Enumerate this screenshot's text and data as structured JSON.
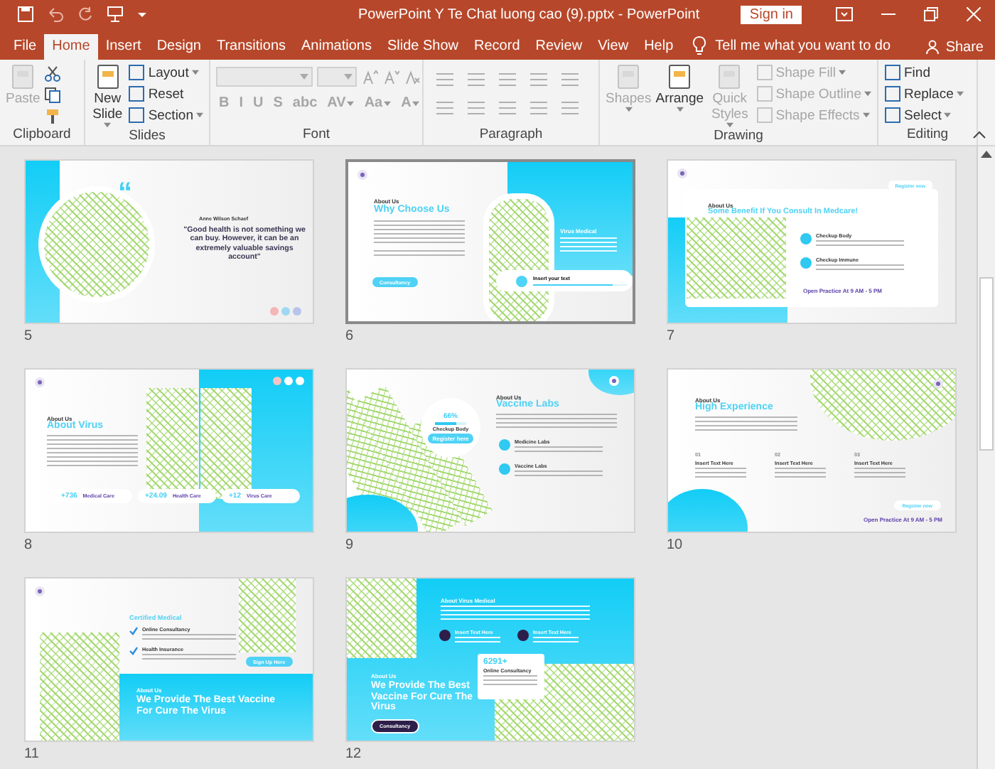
{
  "window": {
    "title": "PowerPoint Y Te Chat luong cao (9).pptx  -  PowerPoint",
    "sign_in": "Sign in"
  },
  "tabs": [
    {
      "label": "File",
      "selected": false
    },
    {
      "label": "Home",
      "selected": true
    },
    {
      "label": "Insert",
      "selected": false
    },
    {
      "label": "Design",
      "selected": false
    },
    {
      "label": "Transitions",
      "selected": false
    },
    {
      "label": "Animations",
      "selected": false
    },
    {
      "label": "Slide Show",
      "selected": false
    },
    {
      "label": "Record",
      "selected": false
    },
    {
      "label": "Review",
      "selected": false
    },
    {
      "label": "View",
      "selected": false
    },
    {
      "label": "Help",
      "selected": false
    }
  ],
  "tell_me": "Tell me what you want to do",
  "share": "Share",
  "ribbon": {
    "groups": [
      {
        "kind": "clipboard",
        "label": "Clipboard",
        "commands": [
          {
            "kind": "large",
            "label": "Paste",
            "disabled": true,
            "dropdown": false
          }
        ]
      },
      {
        "kind": "slides",
        "label": "Slides",
        "commands": [
          {
            "kind": "large",
            "label": "New Slide",
            "disabled": false,
            "dropdown": true
          },
          {
            "kind": "small",
            "label": "Layout",
            "disabled": false,
            "dropdown": true
          },
          {
            "kind": "small",
            "label": "Reset",
            "disabled": false,
            "dropdown": false
          },
          {
            "kind": "small",
            "label": "Section",
            "disabled": false,
            "dropdown": true
          }
        ]
      },
      {
        "kind": "font",
        "label": "Font",
        "commands": [
          {
            "kind": "char",
            "label": "B",
            "disabled": true,
            "dropdown": false
          },
          {
            "kind": "char",
            "label": "I",
            "disabled": true,
            "dropdown": false
          },
          {
            "kind": "char",
            "label": "U",
            "disabled": true,
            "dropdown": false
          },
          {
            "kind": "char",
            "label": "S",
            "disabled": true,
            "dropdown": false
          },
          {
            "kind": "char",
            "label": "abc",
            "disabled": true,
            "dropdown": false
          },
          {
            "kind": "char",
            "label": "AV",
            "disabled": true,
            "dropdown": true
          },
          {
            "kind": "char",
            "label": "Aa",
            "disabled": true,
            "dropdown": true
          },
          {
            "kind": "char",
            "label": "A",
            "disabled": true,
            "dropdown": true
          }
        ]
      },
      {
        "kind": "paragraph",
        "label": "Paragraph"
      },
      {
        "kind": "drawing",
        "label": "Drawing",
        "commands": [
          {
            "kind": "large",
            "label": "Shapes",
            "disabled": true,
            "dropdown": true
          },
          {
            "kind": "large",
            "label": "Arrange",
            "disabled": false,
            "dropdown": true
          },
          {
            "kind": "large",
            "label": "Quick Styles",
            "disabled": true,
            "dropdown": true
          },
          {
            "kind": "small",
            "label": "Shape Fill",
            "disabled": true,
            "dropdown": true
          },
          {
            "kind": "small",
            "label": "Shape Outline",
            "disabled": true,
            "dropdown": true
          },
          {
            "kind": "small",
            "label": "Shape Effects",
            "disabled": true,
            "dropdown": true
          }
        ]
      },
      {
        "kind": "editing",
        "label": "Editing",
        "commands": [
          {
            "kind": "small",
            "label": "Find",
            "disabled": false,
            "dropdown": false
          },
          {
            "kind": "small",
            "label": "Replace",
            "disabled": false,
            "dropdown": true
          },
          {
            "kind": "small",
            "label": "Select",
            "disabled": false,
            "dropdown": true
          }
        ]
      }
    ]
  },
  "slides": [
    {
      "number": "5",
      "kind": "quote",
      "selected": false,
      "author": "Anne Wilson Schaef",
      "quote_mark": "“",
      "quote": "\"Good health is not something we can buy. However, it can be an extremely valuable savings account\""
    },
    {
      "number": "6",
      "kind": "about",
      "selected": true,
      "eyebrow": "About Us",
      "title": "Why Choose Us",
      "button": "Consultancy",
      "side_title": "Virus Medical",
      "progress": {
        "label": "Insert your text",
        "level": 0.85
      }
    },
    {
      "number": "7",
      "kind": "benefit",
      "selected": false,
      "tag": "Register now",
      "eyebrow": "About Us",
      "title": "Some Benefit If You Consult In Medcare!",
      "items": [
        {
          "title": "Checkup Body"
        },
        {
          "title": "Checkup Immune"
        }
      ],
      "footer": "Open Practice At 9 AM - 5 PM"
    },
    {
      "number": "8",
      "kind": "virus",
      "selected": false,
      "eyebrow": "About Us",
      "title": "About Virus",
      "stats": [
        {
          "value": "+736",
          "label": "Medical Care"
        },
        {
          "value": "+24.09",
          "label": "Health Care"
        },
        {
          "value": "+12",
          "label": "Virus Care"
        }
      ]
    },
    {
      "number": "9",
      "kind": "vaccine",
      "selected": false,
      "gauge": {
        "reading": "66%",
        "level": 0.66,
        "label": "Checkup Body"
      },
      "button": "Register here",
      "eyebrow": "About Us",
      "title": "Vaccine Labs",
      "items": [
        {
          "title": "Medicine Labs"
        },
        {
          "title": "Vaccine Labs"
        }
      ]
    },
    {
      "number": "10",
      "kind": "experience",
      "selected": false,
      "eyebrow": "About Us",
      "title": "High Experience",
      "columns": [
        {
          "number": "01",
          "title": "Insert Text Here"
        },
        {
          "number": "02",
          "title": "Insert Text Here"
        },
        {
          "number": "03",
          "title": "Insert Text Here"
        }
      ],
      "button": "Register now",
      "footer": "Open Practice At 9 AM - 5 PM"
    },
    {
      "number": "11",
      "kind": "certified",
      "selected": false,
      "title": "Certified Medical",
      "items": [
        {
          "title": "Online Consultancy"
        },
        {
          "title": "Health Insurance"
        }
      ],
      "button": "Sign Up Here",
      "eyebrow": "About Us",
      "headline": "We Provide The Best Vaccine For Cure The Virus"
    },
    {
      "number": "12",
      "kind": "provide",
      "selected": false,
      "top_title": "About Virus Medical",
      "items": [
        {
          "title": "Insert Text Here"
        },
        {
          "title": "Insert Text Here"
        }
      ],
      "stat": "6291+",
      "stat_label": "Online Consultancy",
      "eyebrow": "About Us",
      "headline": "We Provide The Best Vaccine For Cure The Virus",
      "button": "Consultancy"
    }
  ]
}
